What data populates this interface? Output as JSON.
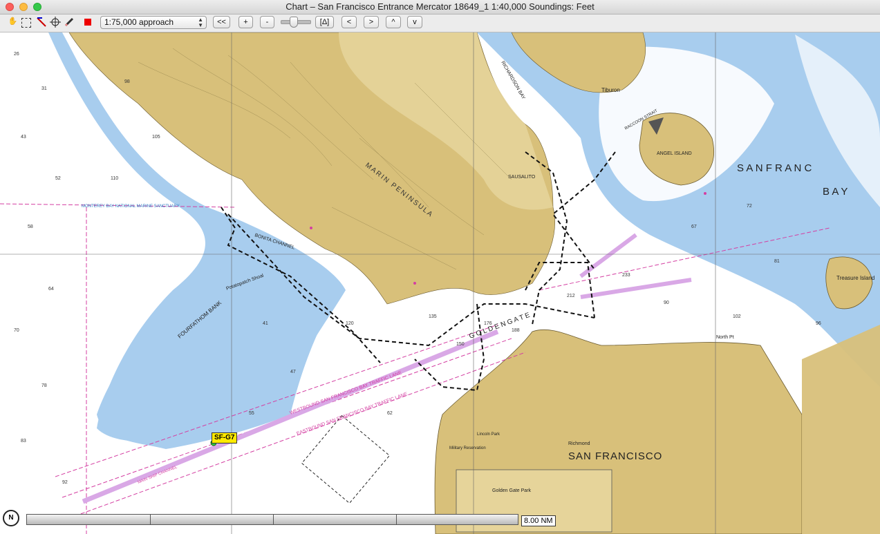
{
  "window": {
    "title": "Chart – San Francisco Entrance Mercator 18649_1 1:40,000  Soundings: Feet"
  },
  "toolbar": {
    "scale_select": "1:75,000 approach",
    "btn_first": "<<",
    "btn_zoom_in": "+",
    "btn_zoom_out": "-",
    "btn_delta": "[Δ]",
    "btn_left": "<",
    "btn_right": ">",
    "btn_up": "^",
    "btn_down": "v"
  },
  "map": {
    "labels": {
      "san_francisco": "SAN FRANCISCO",
      "san_franc": "S A N   F R A N C",
      "bay": "B A Y",
      "marin_peninsula": "MARIN PENINSULA",
      "angel_island": "ANGEL ISLAND",
      "treasure_island": "Treasure Island",
      "sausalito": "SAUSALITO",
      "tiburon": "Tiburon",
      "bonita_channel": "BONITA CHANNEL",
      "fourfathom_bank": "FOURFATHOM BANK",
      "potatopatch_shoal": "Potatopatch Shoal",
      "raccoon_strait": "RACCOON STRAIT",
      "richardson_bay": "RICHARDSON BAY",
      "golden_gate": "G O L D E N   G A T E",
      "golden_gate_park": "Golden Gate Park",
      "richmond": "Richmond",
      "north_pt": "North Pt",
      "westbound_lane": "WESTBOUND SAN FRANCISCO BAY TRAFFIC LANE",
      "eastbound_lane": "EASTBOUND SAN FRANCISCO BAY TRAFFIC LANE",
      "main_ship_channel": "MAIN SHIP CHANNEL",
      "sanctuary": "MONTEREY BAY NATIONAL MARINE SANCTUARY",
      "military_reservation": "Military Reservation",
      "lincoln_park": "Lincoln Park"
    },
    "waypoint": "SF-G7",
    "compass": "N",
    "scale_bar": "8.00 NM"
  },
  "colors": {
    "land": "#d8c07a",
    "land_light": "#e6d49a",
    "shallow_water": "#a8cdee",
    "deep_water": "#ffffff",
    "magenta": "#d43fa2",
    "lane": "#d9a8e6"
  },
  "soundings": [
    "26",
    "31",
    "43",
    "52",
    "58",
    "64",
    "70",
    "78",
    "83",
    "92",
    "98",
    "105",
    "110",
    "120",
    "135",
    "150",
    "176",
    "188",
    "212",
    "233",
    "41",
    "47",
    "55",
    "62",
    "67",
    "72",
    "81",
    "90",
    "96",
    "102"
  ]
}
